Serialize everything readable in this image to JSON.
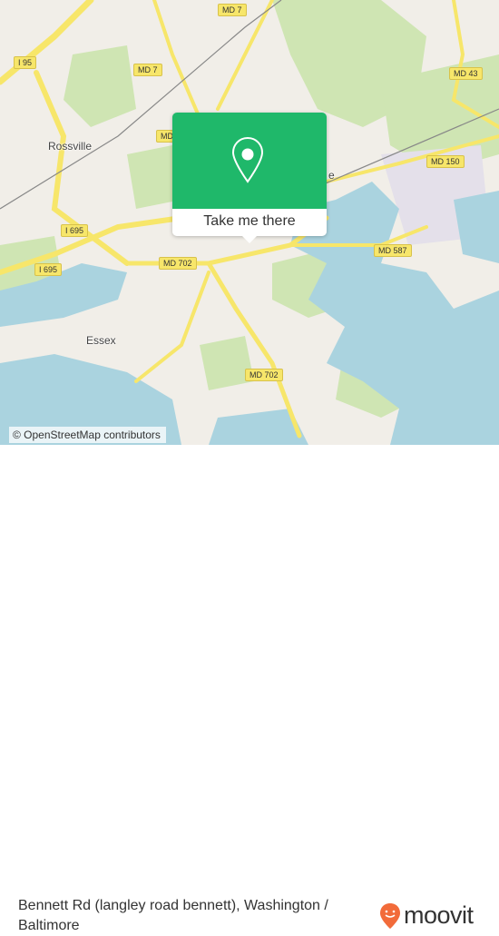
{
  "map": {
    "road_labels": [
      "MD 7",
      "MD 7",
      "I 95",
      "MD 43",
      "MD 150",
      "MD 587",
      "I 695",
      "I 695",
      "MD 702",
      "MD 702",
      "MD"
    ],
    "place_labels": [
      "Rossville",
      "Essex",
      "e"
    ],
    "attribution": "© OpenStreetMap contributors",
    "colors": {
      "land": "#f1eee8",
      "water": "#aad3df",
      "park": "#cfe5b3",
      "road": "#f7e66a",
      "accent": "#1fb86a"
    }
  },
  "popup": {
    "icon": "map-pin-icon",
    "action_label": "Take me there"
  },
  "footer": {
    "title": "Bennett Rd (langley road bennett), Washington / Baltimore",
    "brand": "moovit",
    "brand_color": "#f26b3a"
  }
}
